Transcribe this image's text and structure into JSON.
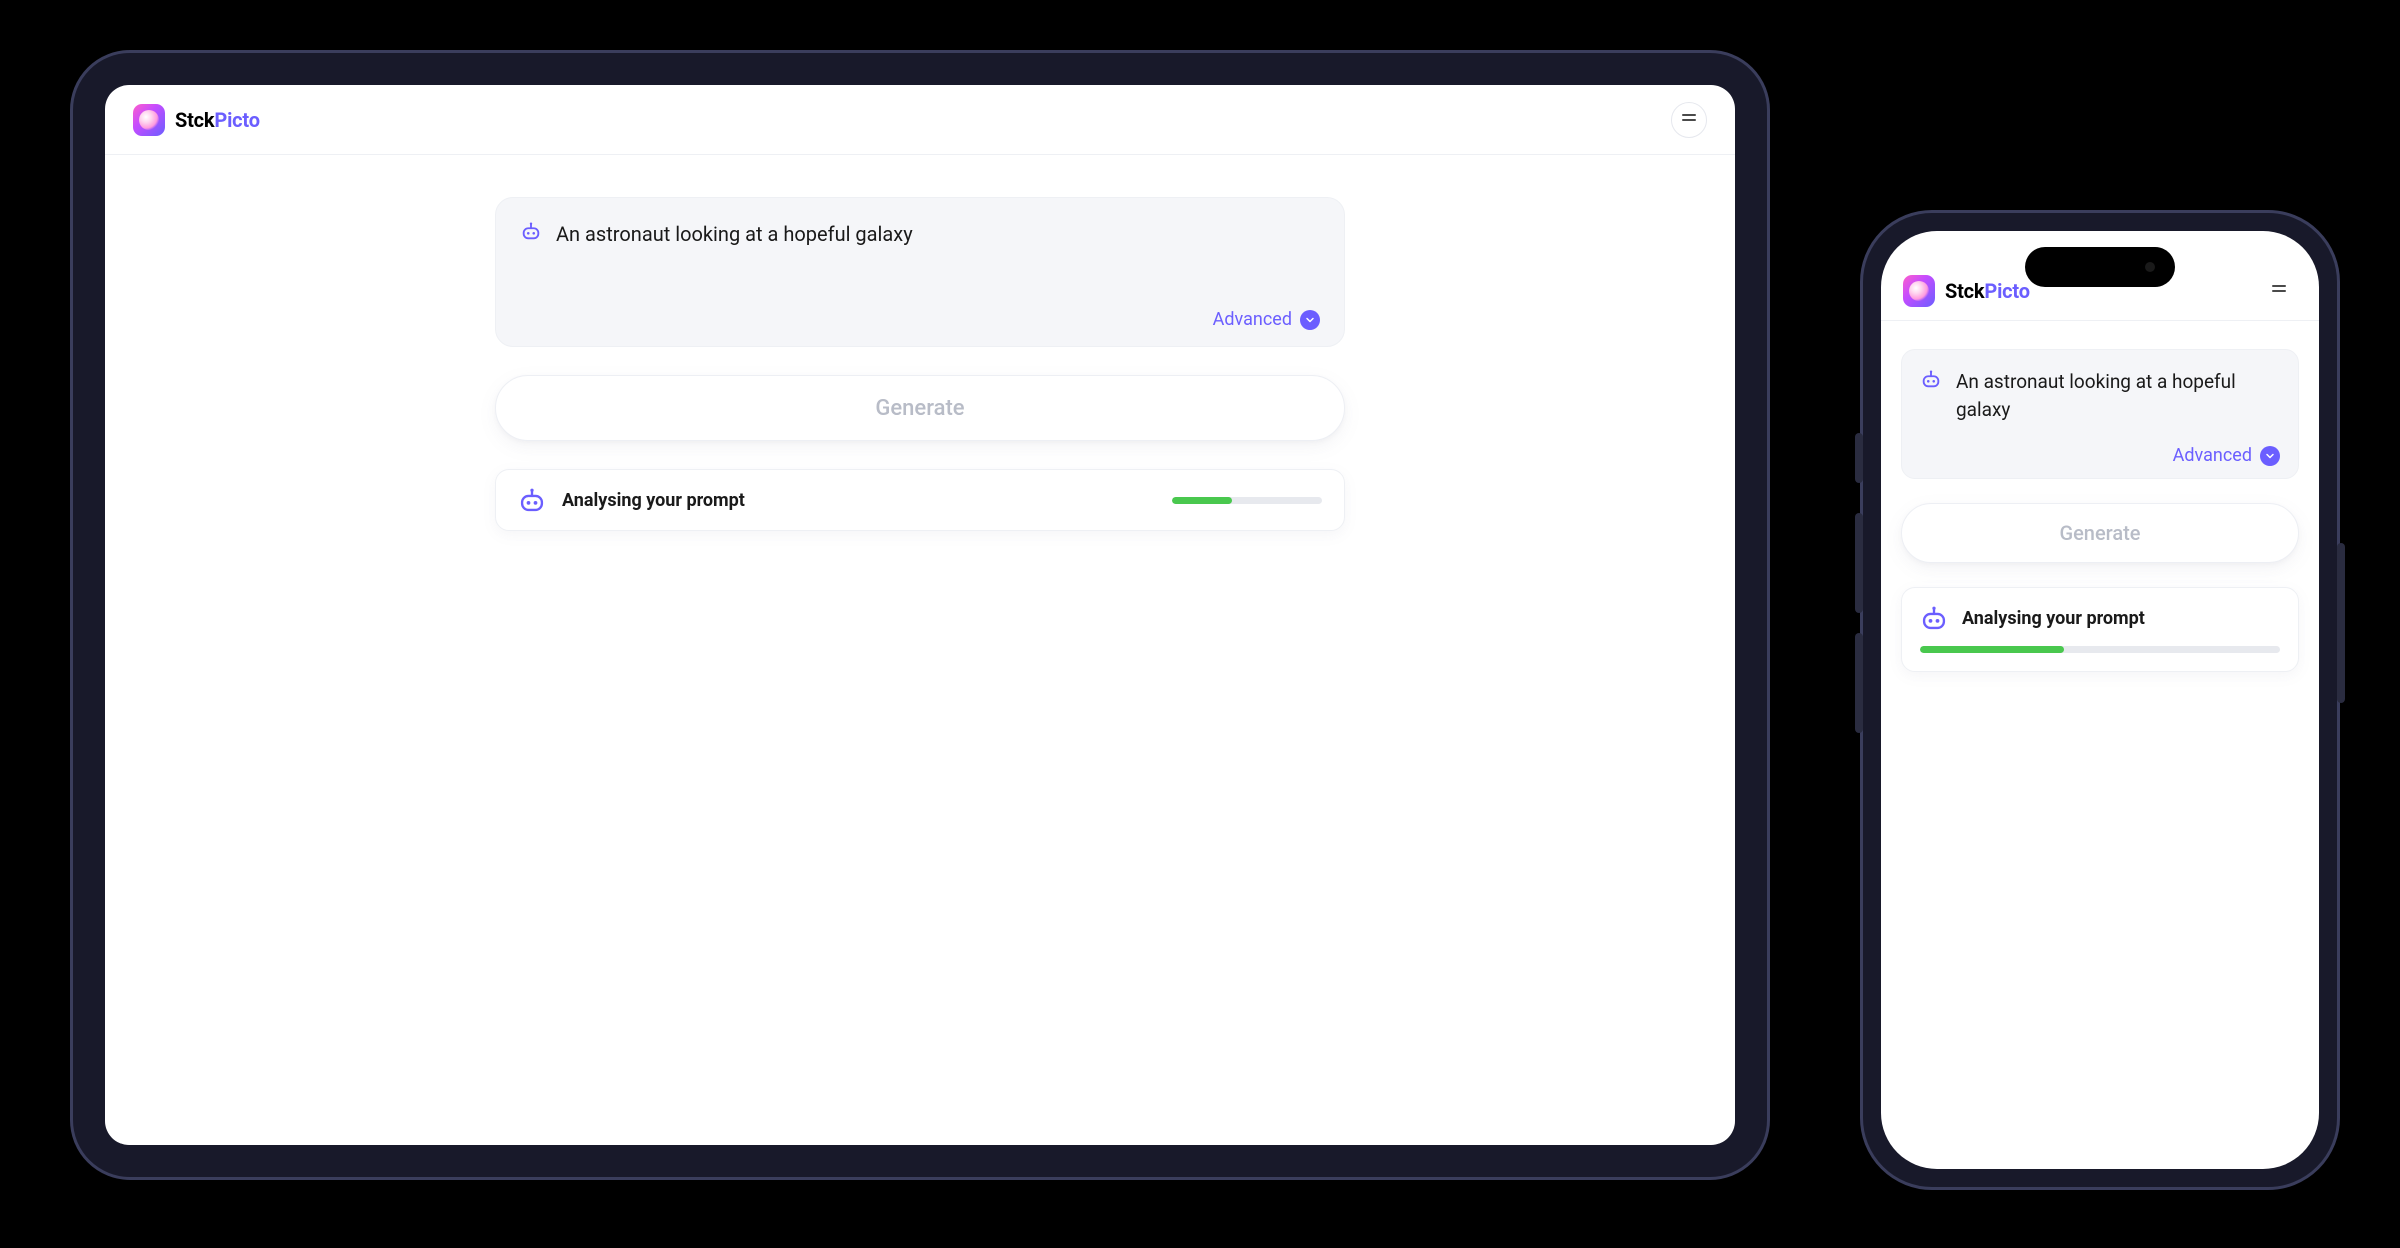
{
  "brand": {
    "name1": "Stck",
    "name2": "Picto"
  },
  "prompt": {
    "text": "An astronaut looking at a hopeful galaxy",
    "advanced_label": "Advanced"
  },
  "generate_label": "Generate",
  "status": {
    "text": "Analysing your prompt",
    "progress_tablet_pct": 40,
    "progress_phone_pct": 40
  },
  "colors": {
    "accent": "#6b5eff",
    "progress": "#49c84e"
  }
}
